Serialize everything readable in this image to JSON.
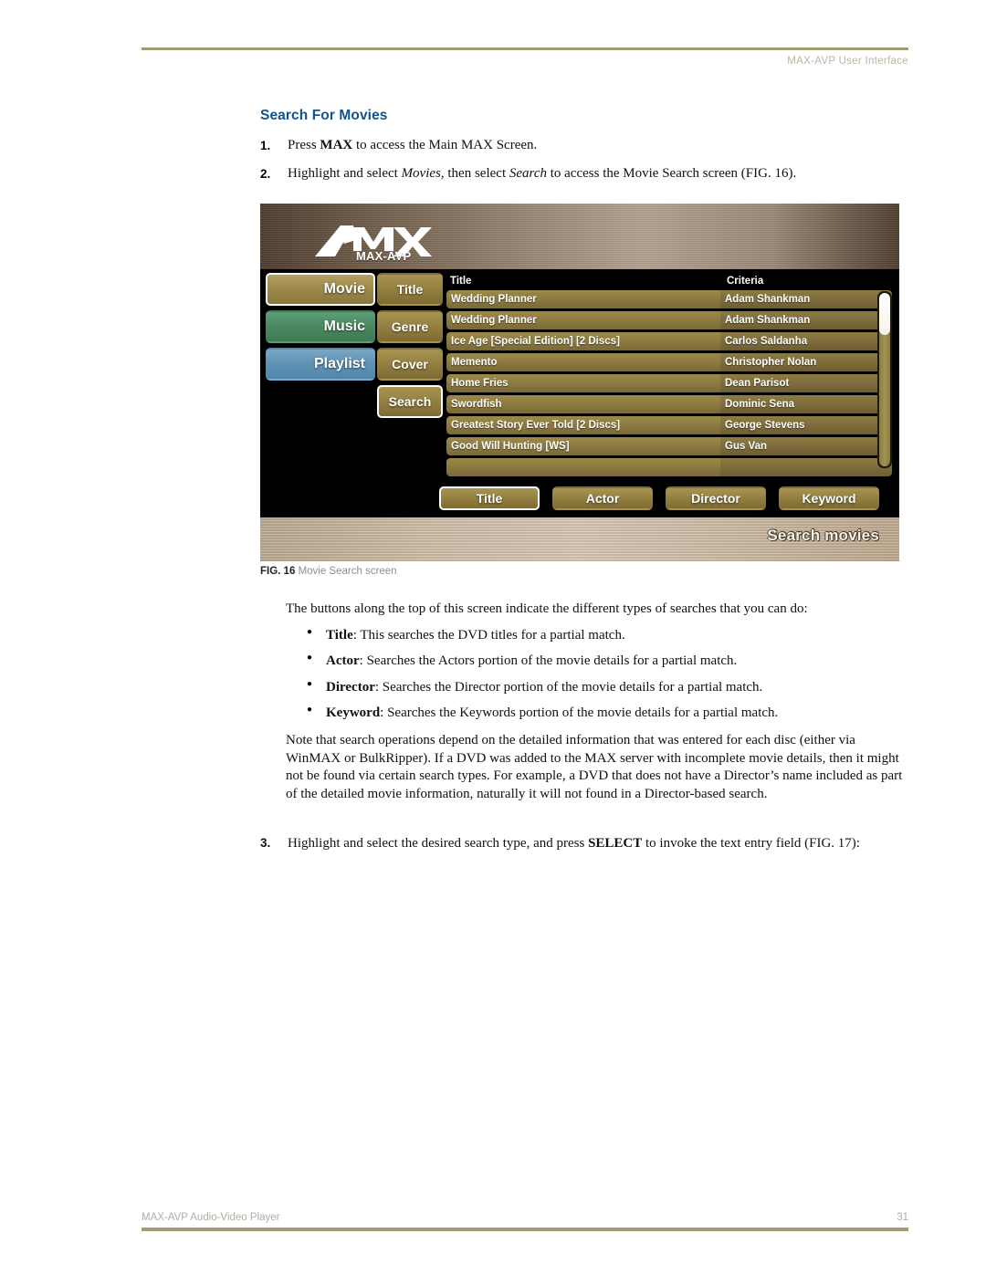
{
  "page": {
    "header_title": "MAX-AVP User Interface",
    "footer_left": "MAX-AVP Audio-Video Player",
    "footer_page_number": "31",
    "accent_rule_color": "#a29b72",
    "heading_color": "#12538f"
  },
  "section": {
    "title": "Search For Movies"
  },
  "steps": [
    {
      "number": "1.",
      "parts": [
        {
          "text": "Press ",
          "style": "normal"
        },
        {
          "text": "MAX",
          "style": "bold"
        },
        {
          "text": " to access the Main MAX Screen.",
          "style": "normal"
        }
      ]
    },
    {
      "number": "2.",
      "parts": [
        {
          "text": "Highlight and select ",
          "style": "normal"
        },
        {
          "text": "Movies",
          "style": "italic"
        },
        {
          "text": ", then select ",
          "style": "normal"
        },
        {
          "text": "Search",
          "style": "italic"
        },
        {
          "text": " to access the Movie Search screen (FIG. 16).",
          "style": "normal"
        }
      ]
    }
  ],
  "figure": {
    "caption_label": "FIG. 16",
    "caption_text": "Movie Search screen",
    "device": {
      "logo_wordmark": "AMX",
      "logo_subtitle": "MAX-AVP",
      "screen_label": "Search movies",
      "left_nav": [
        {
          "label": "Movie",
          "color": "#9e8a4b",
          "selected": true
        },
        {
          "label": "Music",
          "color": "#4b8a62",
          "selected": false
        },
        {
          "label": "Playlist",
          "color": "#5f93b5",
          "selected": false
        }
      ],
      "mid_nav": [
        {
          "label": "Title",
          "selected": false
        },
        {
          "label": "Genre",
          "selected": false
        },
        {
          "label": "Cover",
          "selected": false
        },
        {
          "label": "Search",
          "selected": true
        }
      ],
      "list_headers": [
        "Title",
        "Criteria"
      ],
      "list_rows": [
        {
          "title": "Wedding Planner",
          "criteria": "Adam Shankman"
        },
        {
          "title": "Wedding Planner",
          "criteria": "Adam Shankman"
        },
        {
          "title": "Ice Age [Special Edition] [2 Discs]",
          "criteria": "Carlos Saldanha"
        },
        {
          "title": "Memento",
          "criteria": "Christopher Nolan"
        },
        {
          "title": "Home Fries",
          "criteria": "Dean Parisot"
        },
        {
          "title": "Swordfish",
          "criteria": "Dominic Sena"
        },
        {
          "title": "Greatest Story Ever Told [2 Discs]",
          "criteria": "George Stevens"
        },
        {
          "title": "Good Will Hunting [WS]",
          "criteria": "Gus Van"
        },
        {
          "title": "",
          "criteria": ""
        }
      ],
      "search_type_buttons": [
        {
          "label": "Title",
          "selected": true
        },
        {
          "label": "Actor",
          "selected": false
        },
        {
          "label": "Director",
          "selected": false
        },
        {
          "label": "Keyword",
          "selected": false
        }
      ],
      "scrollbar": {
        "thumb_position": "top"
      }
    }
  },
  "body": {
    "intro": "The buttons along the top of this screen indicate the different types of searches that you can do:",
    "bullets": [
      {
        "term": "Title",
        "rest": ": This searches the DVD titles for a partial match."
      },
      {
        "term": "Actor",
        "rest": ": Searches the Actors portion of the movie details for a partial match."
      },
      {
        "term": "Director",
        "rest": ": Searches the Director portion of the movie details for a partial match."
      },
      {
        "term": "Keyword",
        "rest": ": Searches the Keywords portion of the movie details for a partial match."
      }
    ],
    "note": "Note that search operations depend on the detailed information that was entered for each disc (either via WinMAX or BulkRipper). If a DVD was added to the MAX server with incomplete movie details, then it might not be found via certain search types. For example, a DVD that does not have a Director’s name included as part of the detailed movie information, naturally it will not found in a Director-based search."
  },
  "step3": {
    "number": "3.",
    "parts": [
      {
        "text": "Highlight and select the desired search type, and press ",
        "style": "normal"
      },
      {
        "text": "SELECT",
        "style": "bold"
      },
      {
        "text": " to invoke the text entry field (FIG. 17):",
        "style": "normal"
      }
    ]
  }
}
